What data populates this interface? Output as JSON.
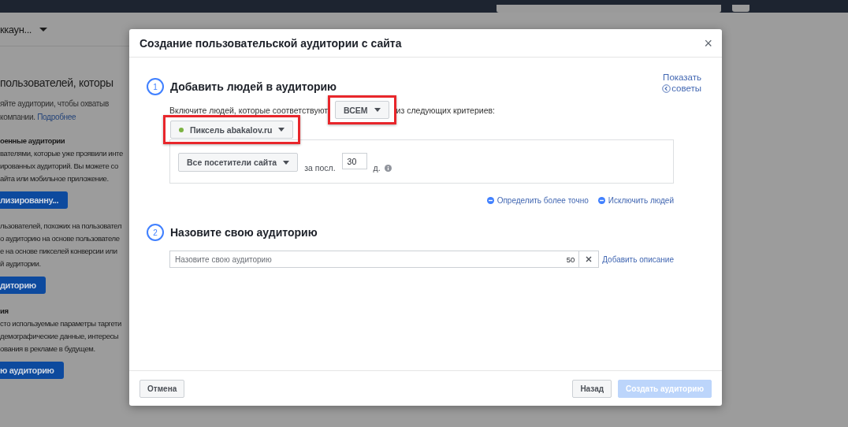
{
  "background": {
    "account_menu": "ккаун...",
    "heading": "пользователей, которы",
    "intro": "яйте аудитории, чтобы охватыв",
    "intro_tail": "компании.",
    "intro_link": "Подробнее",
    "sections": [
      {
        "title": "оенные аудитории",
        "lines": [
          "вателями, которые уже проявили инте",
          "ированных аудиторий. Вы можете со",
          "айта или мобильное приложение."
        ],
        "button": "лизированну..."
      },
      {
        "lines": [
          "льзователей, похожих на пользовател",
          "о аудиторию на основе пользователе",
          "е на основе пикселей конверсии или",
          "й аудитории."
        ],
        "button": "диторию"
      },
      {
        "title": "ия",
        "lines": [
          "сто используемые параметры таргети",
          "демографические данные, интересы",
          "ования в рекламе в будущем."
        ],
        "button": "ю аудиторию"
      }
    ]
  },
  "dialog": {
    "title": "Создание пользовательской аудитории с сайта",
    "close": "×",
    "tips": [
      "Показать",
      "советы"
    ],
    "step1": {
      "number": "1",
      "title": "Добавить людей в аудиторию",
      "criteria_before": "Включите людей, которые соответствуют",
      "match": {
        "label": "ВСЕМ",
        "highlighted": true
      },
      "criteria_after": "из следующих критериев:",
      "pixel": {
        "label": "Пиксель abakalov.ru",
        "highlighted": true
      },
      "rule": {
        "event": "Все посетители сайта",
        "period_label": "за посл.",
        "days": "30",
        "unit": "д."
      },
      "links": [
        "Определить более точно",
        "Исключить людей"
      ]
    },
    "step2": {
      "number": "2",
      "title": "Назовите свою аудиторию",
      "placeholder": "Назовите свою аудиторию",
      "counter": "50",
      "link": "Добавить описание"
    },
    "footer": {
      "cancel": "Отмена",
      "back": "Назад",
      "create": {
        "label": "Создать аудиторию",
        "disabled": true
      }
    }
  }
}
